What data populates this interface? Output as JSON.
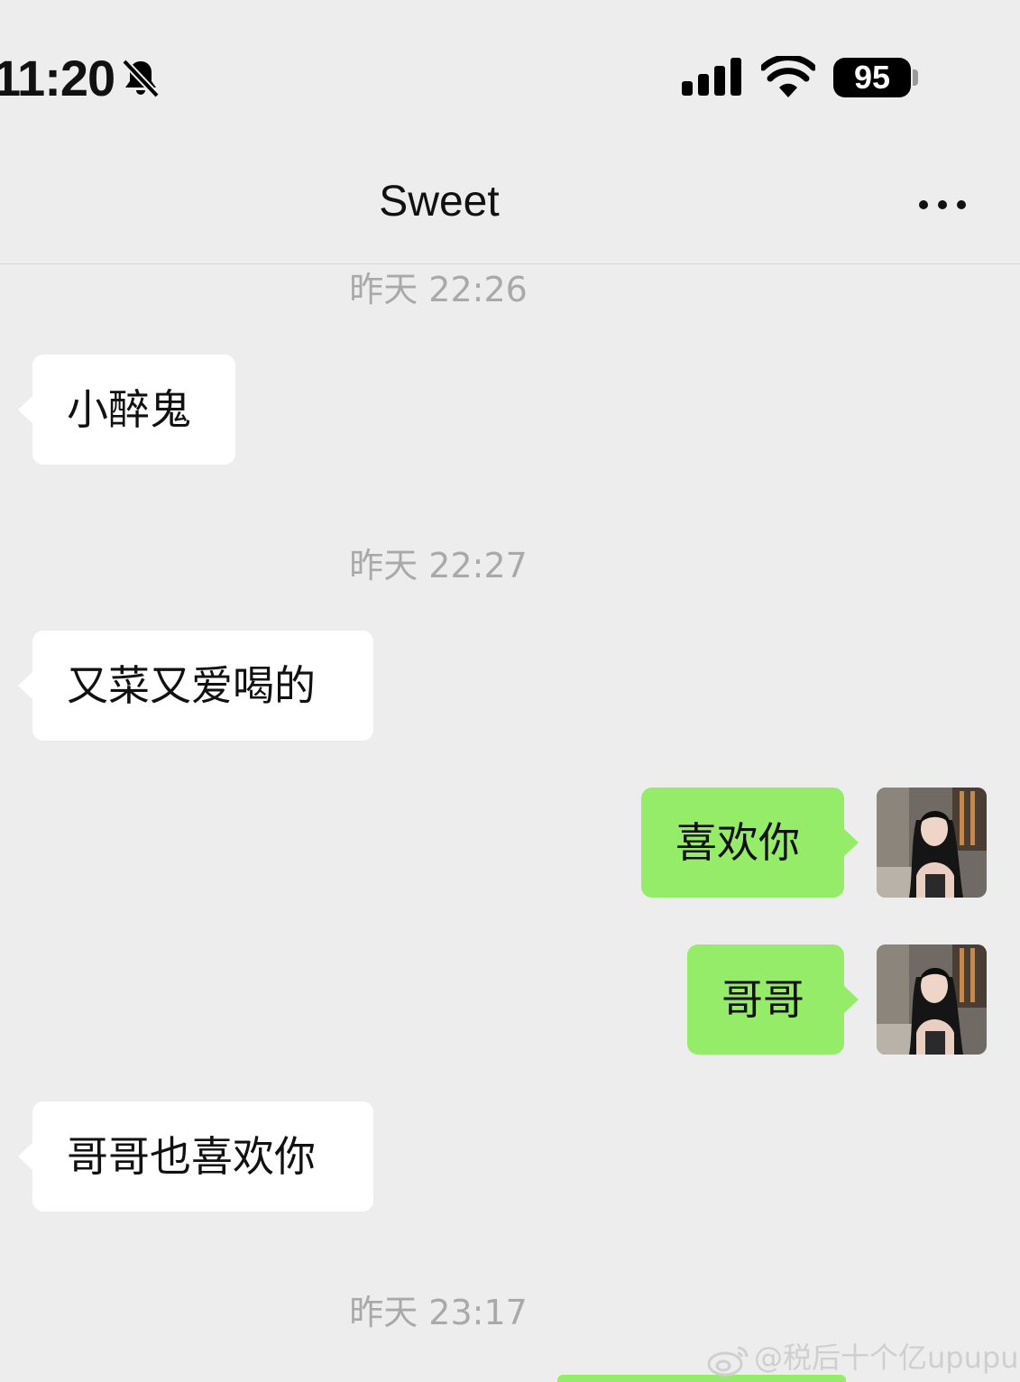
{
  "status_bar": {
    "time": "11:20",
    "battery": "95",
    "icons": [
      "bell-off-icon",
      "cellular-signal-icon",
      "wifi-icon",
      "battery-icon"
    ]
  },
  "header": {
    "title": "Sweet",
    "more_icon": "more-icon"
  },
  "timestamps": [
    "昨天 22:26",
    "昨天 22:27",
    "昨天 23:17"
  ],
  "messages": [
    {
      "side": "incoming",
      "text": "小醉鬼"
    },
    {
      "side": "incoming",
      "text": "又菜又爱喝的"
    },
    {
      "side": "outgoing",
      "text": "喜欢你"
    },
    {
      "side": "outgoing",
      "text": "哥哥"
    },
    {
      "side": "incoming",
      "text": "哥哥也喜欢你"
    }
  ],
  "watermark": {
    "text": "@税后十个亿upupup",
    "icon": "weibo-icon"
  },
  "colors": {
    "background": "#ededed",
    "incoming_bubble": "#ffffff",
    "outgoing_bubble": "#95ec69",
    "timestamp_text": "#a9a9a9"
  }
}
